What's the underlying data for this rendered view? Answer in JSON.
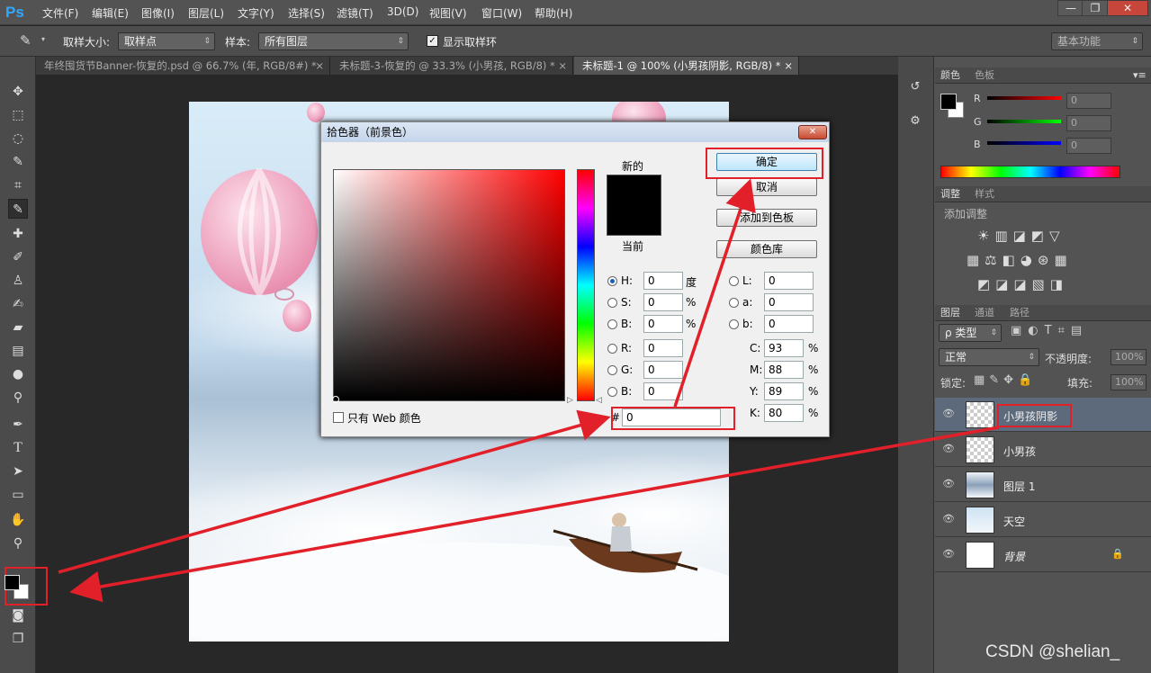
{
  "app": {
    "logo": "Ps"
  },
  "menu": [
    "文件(F)",
    "编辑(E)",
    "图像(I)",
    "图层(L)",
    "文字(Y)",
    "选择(S)",
    "滤镜(T)",
    "3D(D)",
    "视图(V)",
    "窗口(W)",
    "帮助(H)"
  ],
  "window_controls": {
    "minimize": "—",
    "restore": "❐",
    "close": "✕"
  },
  "options": {
    "sample_size_label": "取样大小:",
    "sample_size_value": "取样点",
    "sample_label": "样本:",
    "sample_value": "所有图层",
    "show_ring_label": "显示取样环",
    "workspace": "基本功能"
  },
  "tabs": [
    {
      "label": "年终囤货节Banner-恢复的.psd @ 66.7% (年, RGB/8#) *",
      "close": "×"
    },
    {
      "label": "未标题-3-恢复的 @ 33.3% (小男孩, RGB/8) *",
      "close": "×"
    },
    {
      "label": "未标题-1 @ 100% (小男孩阴影, RGB/8) *",
      "close": "×"
    }
  ],
  "dialog": {
    "title": "拾色器（前景色）",
    "close": "✕",
    "new_label": "新的",
    "current_label": "当前",
    "ok": "确定",
    "cancel": "取消",
    "add_swatch": "添加到色板",
    "libraries": "颜色库",
    "web_only": "只有 Web 颜色",
    "new_color": "#000000",
    "current_color": "#000000",
    "hsb": [
      {
        "label": "H:",
        "value": "0",
        "unit": "度",
        "selected": true
      },
      {
        "label": "S:",
        "value": "0",
        "unit": "%"
      },
      {
        "label": "B:",
        "value": "0",
        "unit": "%"
      }
    ],
    "rgb": [
      {
        "label": "R:",
        "value": "0"
      },
      {
        "label": "G:",
        "value": "0"
      },
      {
        "label": "B:",
        "value": "0"
      }
    ],
    "lab": [
      {
        "label": "L:",
        "value": "0"
      },
      {
        "label": "a:",
        "value": "0"
      },
      {
        "label": "b:",
        "value": "0"
      }
    ],
    "cmyk": [
      {
        "label": "C:",
        "value": "93",
        "unit": "%"
      },
      {
        "label": "M:",
        "value": "88",
        "unit": "%"
      },
      {
        "label": "Y:",
        "value": "89",
        "unit": "%"
      },
      {
        "label": "K:",
        "value": "80",
        "unit": "%"
      }
    ],
    "hex_label": "#",
    "hex": "0"
  },
  "color_panel": {
    "tabs": [
      "颜色",
      "色板"
    ],
    "channels": [
      {
        "label": "R",
        "value": "0",
        "color": "#e01010"
      },
      {
        "label": "G",
        "value": "0",
        "color": "#10c010"
      },
      {
        "label": "B",
        "value": "0",
        "color": "#1030e0"
      }
    ]
  },
  "adjust_panel": {
    "tabs": [
      "调整",
      "样式"
    ],
    "title": "添加调整"
  },
  "layers_panel": {
    "tabs": [
      "图层",
      "通道",
      "路径"
    ],
    "kind": "ρ 类型",
    "blend": "正常",
    "opacity_label": "不透明度:",
    "opacity": "100%",
    "lock_label": "锁定:",
    "fill_label": "填充:",
    "fill": "100%",
    "layers": [
      {
        "name": "小男孩阴影",
        "selected": true
      },
      {
        "name": "小男孩"
      },
      {
        "name": "图层 1"
      },
      {
        "name": "天空"
      },
      {
        "name": "背景",
        "locked": true
      }
    ]
  },
  "watermark": "CSDN @shelian_"
}
